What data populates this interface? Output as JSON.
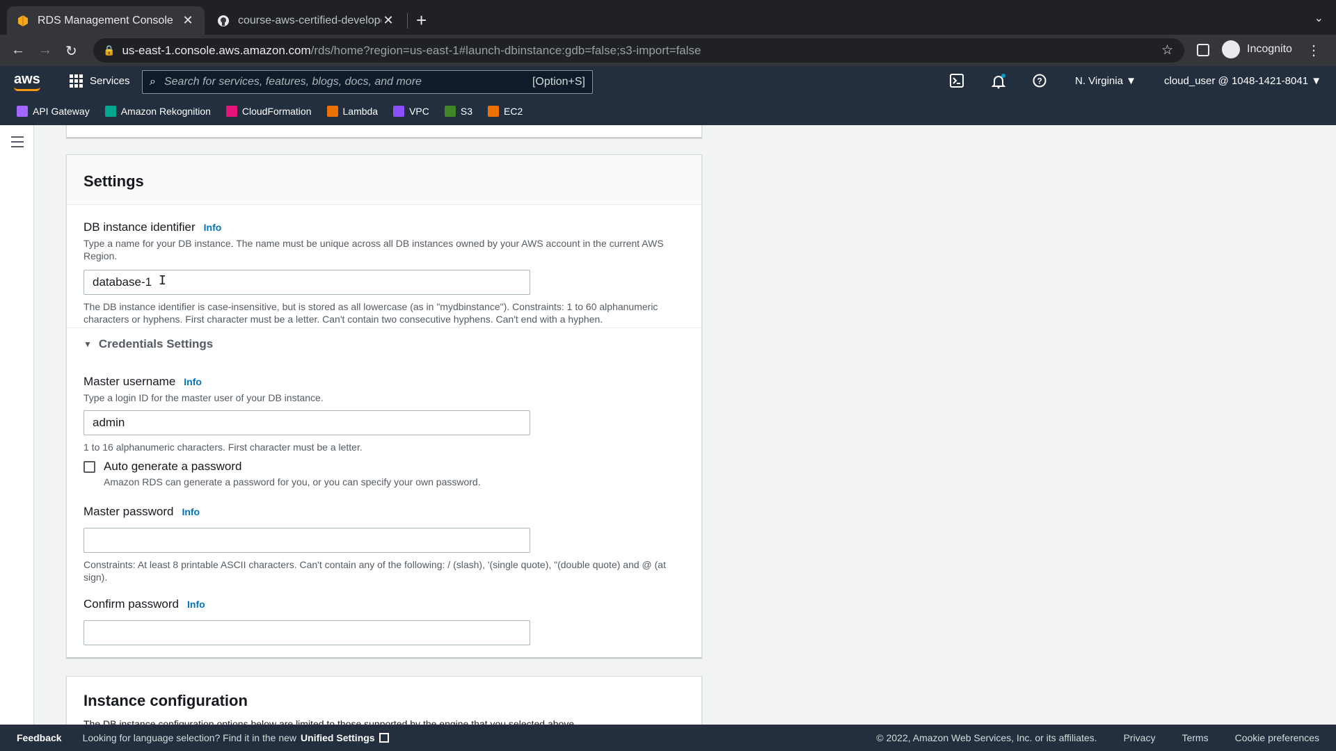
{
  "browser": {
    "tabs": [
      {
        "title": "RDS Management Console",
        "active": true
      },
      {
        "title": "course-aws-certified-developer",
        "active": false
      }
    ],
    "url_host": "us-east-1.console.aws.amazon.com",
    "url_path": "/rds/home?region=us-east-1#launch-dbinstance:gdb=false;s3-import=false",
    "profile_label": "Incognito"
  },
  "aws_header": {
    "logo": "aws",
    "services_label": "Services",
    "search_placeholder": "Search for services, features, blogs, docs, and more",
    "search_shortcut": "[Option+S]",
    "region": "N. Virginia",
    "account": "cloud_user @ 1048-1421-8041"
  },
  "favorites": [
    {
      "label": "API Gateway",
      "color": "#a166ff"
    },
    {
      "label": "Amazon Rekognition",
      "color": "#01a88d"
    },
    {
      "label": "CloudFormation",
      "color": "#e7157b"
    },
    {
      "label": "Lambda",
      "color": "#ed7100"
    },
    {
      "label": "VPC",
      "color": "#8c4fff"
    },
    {
      "label": "S3",
      "color": "#3f8624"
    },
    {
      "label": "EC2",
      "color": "#ed7100"
    }
  ],
  "settings": {
    "title": "Settings",
    "db_identifier": {
      "label": "DB instance identifier",
      "info": "Info",
      "description": "Type a name for your DB instance. The name must be unique across all DB instances owned by your AWS account in the current AWS Region.",
      "value": "database-1",
      "constraint": "The DB instance identifier is case-insensitive, but is stored as all lowercase (as in \"mydbinstance\"). Constraints: 1 to 60 alphanumeric characters or hyphens. First character must be a letter. Can't contain two consecutive hyphens. Can't end with a hyphen."
    },
    "credentials_toggle": "Credentials Settings",
    "master_username": {
      "label": "Master username",
      "info": "Info",
      "description": "Type a login ID for the master user of your DB instance.",
      "value": "admin",
      "constraint": "1 to 16 alphanumeric characters. First character must be a letter."
    },
    "auto_generate": {
      "label": "Auto generate a password",
      "description": "Amazon RDS can generate a password for you, or you can specify your own password."
    },
    "master_password": {
      "label": "Master password",
      "info": "Info",
      "value": "",
      "constraint": "Constraints: At least 8 printable ASCII characters. Can't contain any of the following: / (slash), '(single quote), \"(double quote) and @ (at sign)."
    },
    "confirm_password": {
      "label": "Confirm password",
      "info": "Info",
      "value": ""
    }
  },
  "instance_config": {
    "title": "Instance configuration",
    "description": "The DB instance configuration options below are limited to those supported by the engine that you selected above."
  },
  "footer": {
    "feedback": "Feedback",
    "language_hint": "Looking for language selection? Find it in the new",
    "unified_settings": "Unified Settings",
    "copyright": "© 2022, Amazon Web Services, Inc. or its affiliates.",
    "privacy": "Privacy",
    "terms": "Terms",
    "cookie": "Cookie preferences"
  }
}
